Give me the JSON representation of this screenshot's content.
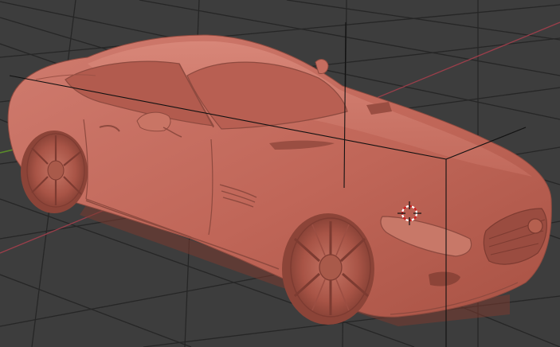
{
  "viewport": {
    "background": "#3d3d3d",
    "grid_color": "#262626",
    "x_axis_color": "#9a3e4a",
    "y_axis_color": "#5a8a2a",
    "object_color": "#c66a5e",
    "bbox_color": "#111111"
  },
  "scene": {
    "object": "car-model",
    "shading": "solid",
    "bounding_box_visible": true,
    "cursor_3d_visible": true
  }
}
